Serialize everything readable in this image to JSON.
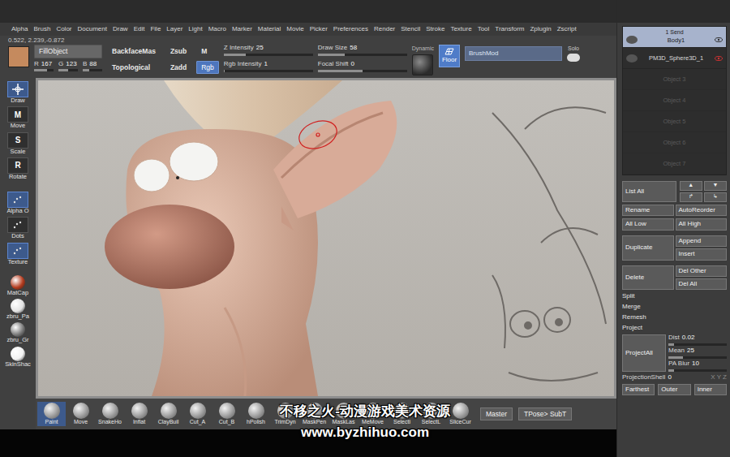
{
  "menu": [
    "Alpha",
    "Brush",
    "Color",
    "Document",
    "Draw",
    "Edit",
    "File",
    "Layer",
    "Light",
    "Macro",
    "Marker",
    "Material",
    "Movie",
    "Picker",
    "Preferences",
    "Render",
    "Stencil",
    "Stroke",
    "Texture",
    "Tool",
    "Transform",
    "Zplugin",
    "Zscript"
  ],
  "coords": "0.522, 2.239,-0.872",
  "toolbar": {
    "color": "#c58a5e",
    "fill_object": {
      "label": "FillObject",
      "selected": false
    },
    "rgb": [
      {
        "label": "R",
        "value": "167",
        "level": 0.65
      },
      {
        "label": "G",
        "value": "123",
        "level": 0.48
      },
      {
        "label": "B",
        "value": "88",
        "level": 0.35
      }
    ],
    "options": [
      {
        "label": "BackfaceMas",
        "selected": false
      },
      {
        "label": "Topological",
        "selected": false
      }
    ],
    "modes": [
      {
        "label": "Zsub",
        "selected": false
      },
      {
        "label": "Zadd",
        "selected": false
      }
    ],
    "channels": [
      {
        "label": "M",
        "selected": false
      },
      {
        "label": "Rgb",
        "selected": true
      }
    ],
    "sliders": [
      {
        "label": "Z Intensity",
        "value": "25",
        "level": 0.25
      },
      {
        "label": "Rgb Intensity",
        "value": "1",
        "level": 0.01
      },
      {
        "label": "Draw Size",
        "value": "58",
        "level": 0.3
      },
      {
        "label": "Focal Shift",
        "value": "0",
        "level": 0.5
      }
    ],
    "dynamic": "Dynamic",
    "floor": {
      "label": "Floor",
      "selected": true
    },
    "brush_mod": "BrushMod",
    "solo": "Solo"
  },
  "shelf": [
    {
      "label": "Draw",
      "glyph": "",
      "selected": true
    },
    {
      "label": "Move",
      "glyph": "M",
      "selected": false
    },
    {
      "label": "Scale",
      "glyph": "S",
      "selected": false
    },
    {
      "label": "Rotate",
      "glyph": "R",
      "selected": false
    }
  ],
  "stroke_tools": [
    {
      "label": "Alpha O",
      "selected": true
    },
    {
      "label": "Dots",
      "selected": false
    },
    {
      "label": "Texture",
      "selected": true
    }
  ],
  "materials": [
    {
      "label": "MatCap",
      "color": "#b33a1d"
    },
    {
      "label": "zbru_Pa",
      "color": "#e4e4e4"
    },
    {
      "label": "zbru_Gr",
      "color": "#7a7a7a"
    },
    {
      "label": "SkinShac",
      "color": "#f2f2f2"
    }
  ],
  "brushes": [
    {
      "label": "Paint",
      "selected": true
    },
    {
      "label": "Move",
      "selected": false
    },
    {
      "label": "SnakeHo",
      "selected": false
    },
    {
      "label": "Inflat",
      "selected": false
    },
    {
      "label": "ClayBuil",
      "selected": false
    },
    {
      "label": "Cut_A",
      "selected": false
    },
    {
      "label": "Cut_B",
      "selected": false
    },
    {
      "label": "hPolish",
      "selected": false
    },
    {
      "label": "TrimDyn",
      "selected": false
    },
    {
      "label": "MaskPen",
      "selected": false
    },
    {
      "label": "MaskLas",
      "selected": false
    },
    {
      "label": "MeMove",
      "selected": false
    },
    {
      "label": "Selecti",
      "selected": false
    },
    {
      "label": "SelectL",
      "selected": false
    },
    {
      "label": "SliceCur",
      "selected": false
    }
  ],
  "bottom_buttons": [
    "Master",
    "TPose> SubT"
  ],
  "watermark": [
    "不移之火-动漫游戏美术资源",
    "www.byzhihuo.com"
  ],
  "subtool": {
    "items": [
      {
        "header": "1 Send",
        "label": "Body1",
        "selected": true
      },
      {
        "header": "",
        "label": "PM3D_Sphere3D_1",
        "selected": false
      }
    ],
    "slots": [
      "Object 3",
      "Object 4",
      "Object 5",
      "Object 6",
      "Object 7"
    ],
    "list_all": "List All",
    "arrows": [
      "▲",
      "▼",
      "↱",
      "↳"
    ],
    "pairs": [
      [
        "Rename",
        "AutoReorder"
      ],
      [
        "All Low",
        "All High"
      ]
    ],
    "duplicate": "Duplicate",
    "dup_small": [
      "Append",
      "Insert"
    ],
    "delete": "Delete",
    "del_small": [
      "Del Other",
      "Del All"
    ],
    "actions": [
      "Split",
      "Merge",
      "Remesh",
      "Project"
    ],
    "project_all": "ProjectAll",
    "project_sliders": [
      {
        "label": "Dist",
        "value": "0.02",
        "level": 0.1
      },
      {
        "label": "Mean",
        "value": "25",
        "level": 0.25
      },
      {
        "label": "PA Blur",
        "value": "10",
        "level": 0.1
      }
    ],
    "shell": {
      "label": "ProjectionShell",
      "value": "0",
      "axes": "X Y Z"
    },
    "bottom": [
      "Farthest",
      "Outer",
      "Inner"
    ]
  }
}
